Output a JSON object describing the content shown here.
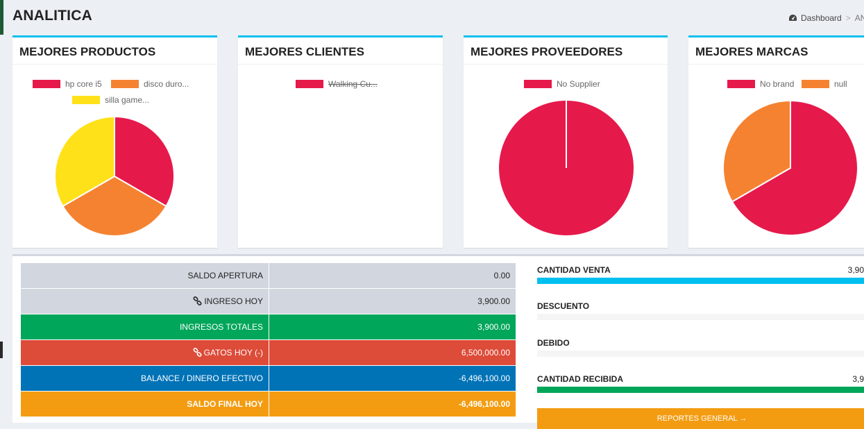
{
  "header": {
    "title": "ANALITICA"
  },
  "breadcrumb": {
    "home": "Dashboard",
    "current": "AN"
  },
  "panels": {
    "productos": {
      "title": "MEJORES PRODUCTOS",
      "legend": [
        "hp core i5",
        "disco duro...",
        "silla game..."
      ]
    },
    "clientes": {
      "title": "MEJORES CLIENTES",
      "legend": [
        "Walking Cu..."
      ]
    },
    "proveedores": {
      "title": "MEJORES PROVEEDORES",
      "legend": [
        "No Supplier"
      ]
    },
    "marcas": {
      "title": "MEJORES MARCAS",
      "legend": [
        "No brand",
        "null"
      ]
    }
  },
  "chart_data": [
    {
      "type": "pie",
      "title": "MEJORES PRODUCTOS",
      "categories": [
        "hp core i5",
        "disco duro...",
        "silla game..."
      ],
      "values": [
        1,
        1,
        1
      ],
      "colors": [
        "#e6194b",
        "#f58231",
        "#ffe119"
      ],
      "legend": "top"
    },
    {
      "type": "pie",
      "title": "MEJORES CLIENTES",
      "categories": [
        "Walking Cu..."
      ],
      "values": [],
      "colors": [
        "#e6194b"
      ],
      "legend": "top"
    },
    {
      "type": "pie",
      "title": "MEJORES PROVEEDORES",
      "categories": [
        "No Supplier"
      ],
      "values": [
        1
      ],
      "colors": [
        "#e6194b"
      ],
      "legend": "top"
    },
    {
      "type": "pie",
      "title": "MEJORES MARCAS",
      "categories": [
        "No brand",
        "null"
      ],
      "values": [
        2,
        1
      ],
      "colors": [
        "#e6194b",
        "#f58231"
      ],
      "legend": "top"
    }
  ],
  "finance": {
    "rows": [
      {
        "label": "SALDO APERTURA",
        "value": "0.00",
        "icon": ""
      },
      {
        "label": "INGRESO HOY",
        "value": "3,900.00",
        "icon": "link-icon"
      },
      {
        "label": "INGRESOS TOTALES",
        "value": "3,900.00",
        "icon": ""
      },
      {
        "label": "GATOS HOY (-)",
        "value": "6,500,000.00",
        "icon": "link-icon"
      },
      {
        "label": "BALANCE / DINERO EFECTIVO",
        "value": "-6,496,100.00",
        "icon": ""
      },
      {
        "label": "SALDO FINAL HOY",
        "value": "-6,496,100.00",
        "icon": ""
      }
    ]
  },
  "stats": [
    {
      "label": "CANTIDAD VENTA",
      "value": "3,90",
      "progress": 1.0,
      "color": "#00c0ef"
    },
    {
      "label": "DESCUENTO",
      "value": "",
      "progress": 0,
      "color": "#dd4b39"
    },
    {
      "label": "DEBIDO",
      "value": "",
      "progress": 0,
      "color": "#f39c12"
    },
    {
      "label": "CANTIDAD RECIBIDA",
      "value": "3,9",
      "progress": 1.0,
      "color": "#00a65a"
    }
  ],
  "report_button": {
    "label": "REPORTES GENERAL →"
  },
  "colors": {
    "accent": "#00c0ef",
    "green": "#00a65a",
    "red": "#dd4b39",
    "blue": "#0073b7",
    "orange": "#f39c12",
    "pie_red": "#e6194b",
    "pie_orange": "#f58231",
    "pie_yellow": "#ffe119"
  }
}
